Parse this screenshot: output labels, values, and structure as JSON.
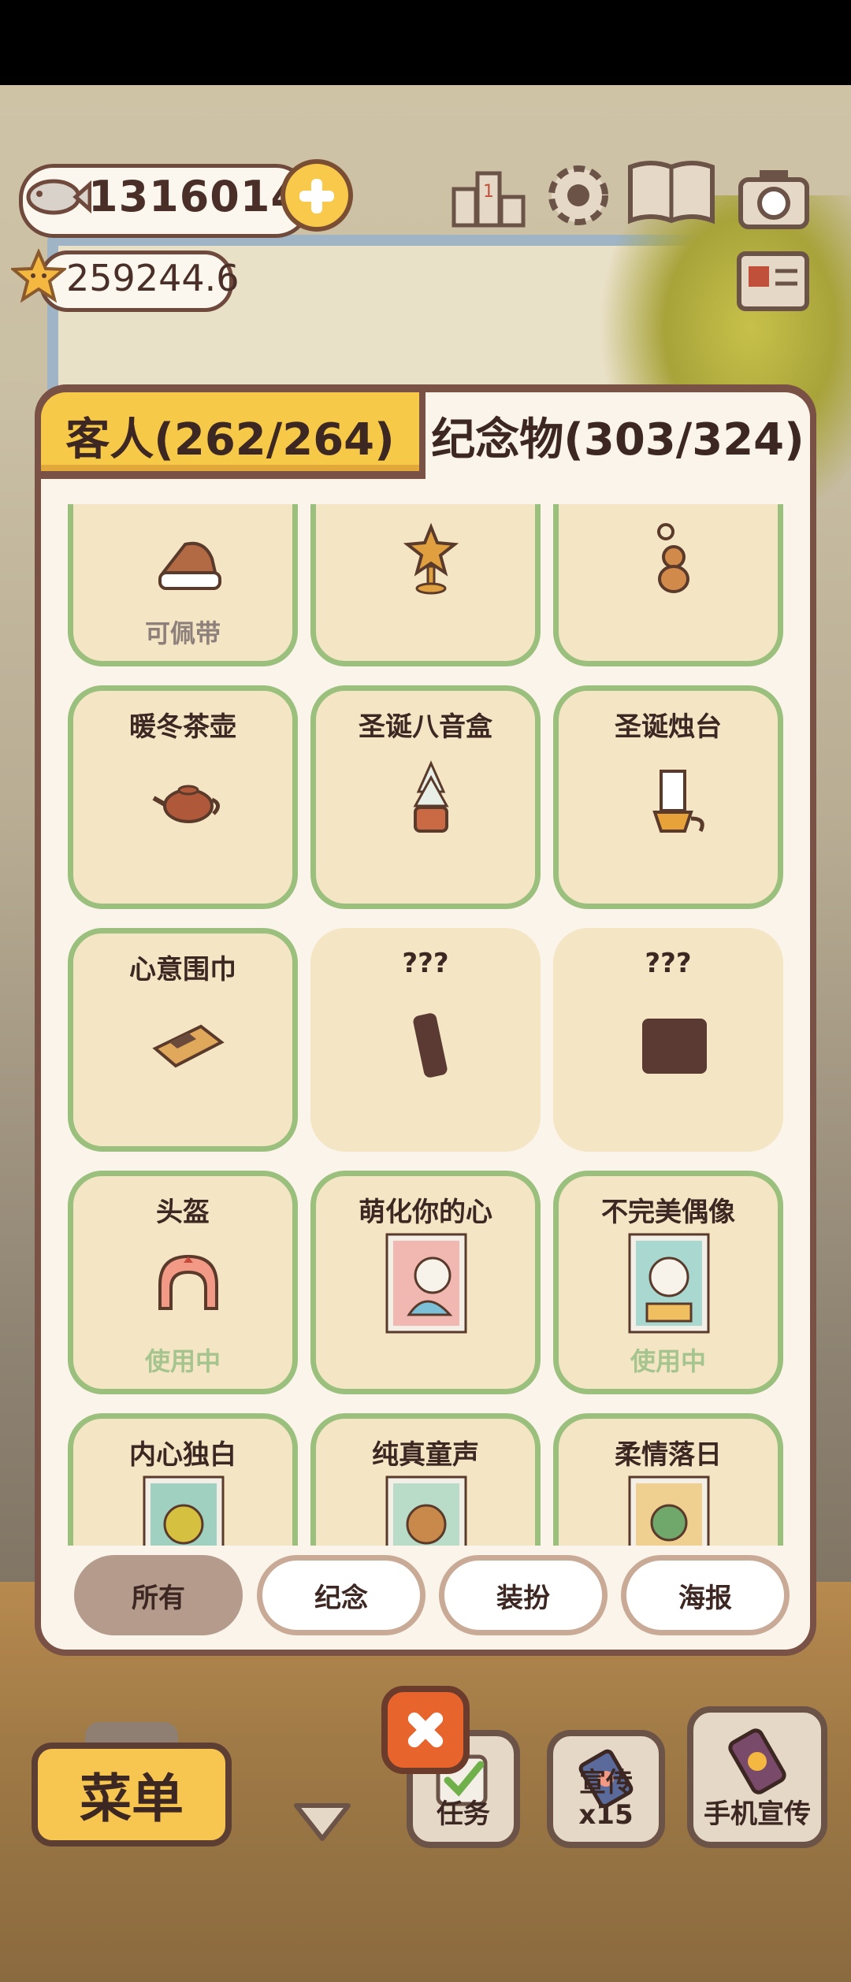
{
  "currency": {
    "fish": "13160149",
    "stars": "259244.6"
  },
  "tabs": {
    "guests": "客人(262/264)",
    "souvenirs": "纪念物(303/324)"
  },
  "cards": {
    "r0c0_status": "可佩带",
    "r1c0": "暖冬茶壶",
    "r1c1": "圣诞八音盒",
    "r1c2": "圣诞烛台",
    "r2c0": "心意围巾",
    "r2c1": "???",
    "r2c2": "???",
    "r3c0": "头盔",
    "r3c0_status": "使用中",
    "r3c1": "萌化你的心",
    "r3c2": "不完美偶像",
    "r3c2_status": "使用中",
    "r4c0": "内心独白",
    "r4c1": "纯真童声",
    "r4c2": "柔情落日"
  },
  "filters": {
    "all": "所有",
    "souvenir": "纪念",
    "dressup": "装扮",
    "poster": "海报"
  },
  "hud": {
    "menu": "菜单",
    "task": "任务",
    "promote": "宣传x15",
    "phone_promote": "手机宣传"
  },
  "colors": {
    "accent_yellow": "#f7c948",
    "card_border": "#9bc07d",
    "card_bg": "#f4e6c4",
    "close_orange": "#e8642d"
  }
}
